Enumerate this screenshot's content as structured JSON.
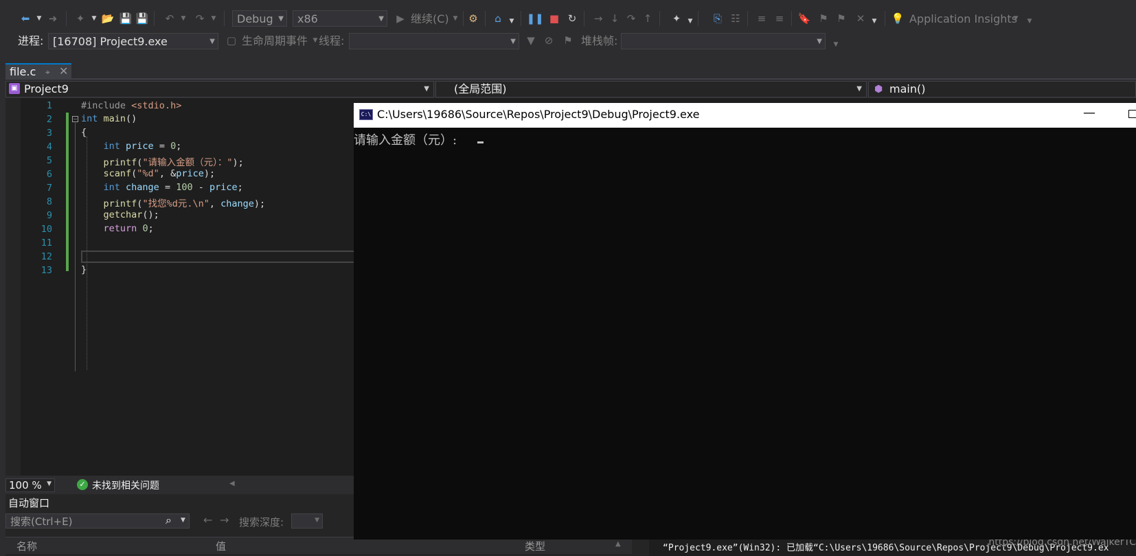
{
  "toolbar": {
    "configuration": "Debug",
    "platform": "x86",
    "continue_label": "继续(C)",
    "app_insights_label": "Application Insights"
  },
  "toolbar2": {
    "process_label": "进程:",
    "process_value": "[16708] Project9.exe",
    "lifecycle_label": "生命周期事件",
    "thread_label": "线程:",
    "stack_frame_label": "堆栈帧:"
  },
  "tab": {
    "filename": "file.c"
  },
  "navbar": {
    "project": "Project9",
    "scope": "(全局范围)",
    "member": "main()"
  },
  "editor": {
    "line_numbers": [
      "1",
      "2",
      "3",
      "4",
      "5",
      "6",
      "7",
      "8",
      "9",
      "10",
      "11",
      "12",
      "13"
    ],
    "zoom": "100 %",
    "issues_status": "未找到相关问题"
  },
  "autos": {
    "title": "自动窗口",
    "search_placeholder": "搜索(Ctrl+E)",
    "search_depth_label": "搜索深度:",
    "col_name": "名称",
    "col_value": "值",
    "col_type": "类型"
  },
  "console": {
    "title": "C:\\Users\\19686\\Source\\Repos\\Project9\\Debug\\Project9.exe",
    "icon_text": "C:\\",
    "prompt": "请输入金额（元）: "
  },
  "output": {
    "line1": "“Project9.exe”(Win32): 已加载“C:\\Users\\19686\\Source\\Repos\\Project9\\Debug\\Project9.ex",
    "watermark": "https://blog.csdn.net/WalkerTC"
  },
  "colors": {
    "accent": "#007acc",
    "change_bar": "#57a64a",
    "keyword": "#569cd6",
    "string": "#d69d85"
  }
}
